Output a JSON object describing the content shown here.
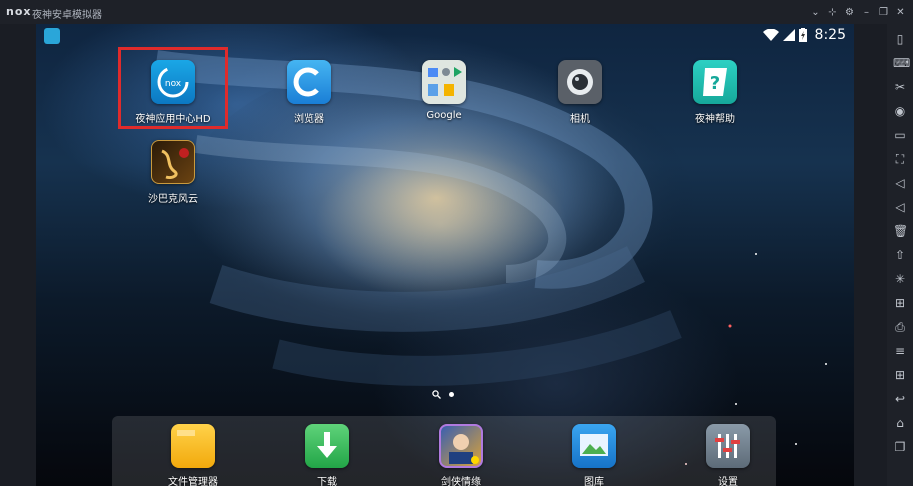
{
  "titlebar": {
    "logo": "nox",
    "title": "夜神安卓模拟器",
    "buttons": [
      {
        "name": "chevron-down-icon",
        "glyph": "⌄"
      },
      {
        "name": "pin-icon",
        "glyph": "⊹"
      },
      {
        "name": "gear-icon",
        "glyph": "⚙"
      },
      {
        "name": "minimize-icon",
        "glyph": "–"
      },
      {
        "name": "restore-icon",
        "glyph": "❐"
      },
      {
        "name": "close-icon",
        "glyph": "✕"
      }
    ]
  },
  "statusbar": {
    "time": "8:25"
  },
  "apps": [
    {
      "label": "夜神应用中心HD",
      "icon": "nox-appcenter-icon"
    },
    {
      "label": "浏览器",
      "icon": "browser-icon"
    },
    {
      "label": "Google",
      "icon": "google-folder-icon"
    },
    {
      "label": "相机",
      "icon": "camera-icon"
    },
    {
      "label": "夜神帮助",
      "icon": "help-icon"
    },
    {
      "label": "沙巴克风云",
      "icon": "game-shabake-icon"
    }
  ],
  "dock": [
    {
      "label": "文件管理器",
      "icon": "folder-icon"
    },
    {
      "label": "下载",
      "icon": "download-icon"
    },
    {
      "label": "剑侠情缘",
      "icon": "game-jianxia-icon"
    },
    {
      "label": "图库",
      "icon": "gallery-icon"
    },
    {
      "label": "设置",
      "icon": "settings-icon"
    }
  ],
  "sidebar": [
    {
      "name": "phone-rotate-icon",
      "glyph": "▯"
    },
    {
      "name": "keyboard-icon",
      "glyph": "⌨"
    },
    {
      "name": "scissors-icon",
      "glyph": "✂"
    },
    {
      "name": "location-icon",
      "glyph": "◉"
    },
    {
      "name": "screen-icon",
      "glyph": "▭"
    },
    {
      "name": "fullscreen-icon",
      "glyph": "⛶"
    },
    {
      "name": "volume-up-icon",
      "glyph": "◁"
    },
    {
      "name": "volume-down-icon",
      "glyph": "◁"
    },
    {
      "name": "trash-icon",
      "glyph": "🗑"
    },
    {
      "name": "install-apk-icon",
      "glyph": "⇧"
    },
    {
      "name": "loading-icon",
      "glyph": "✳"
    },
    {
      "name": "multi-instance-icon",
      "glyph": "⊞"
    },
    {
      "name": "macro-icon",
      "glyph": "⎙"
    },
    {
      "name": "menu-icon",
      "glyph": "≡"
    },
    {
      "name": "add-icon",
      "glyph": "⊞"
    },
    {
      "name": "back-icon",
      "glyph": "↩"
    },
    {
      "name": "home-icon",
      "glyph": "⌂"
    },
    {
      "name": "recent-apps-icon",
      "glyph": "❐"
    }
  ]
}
